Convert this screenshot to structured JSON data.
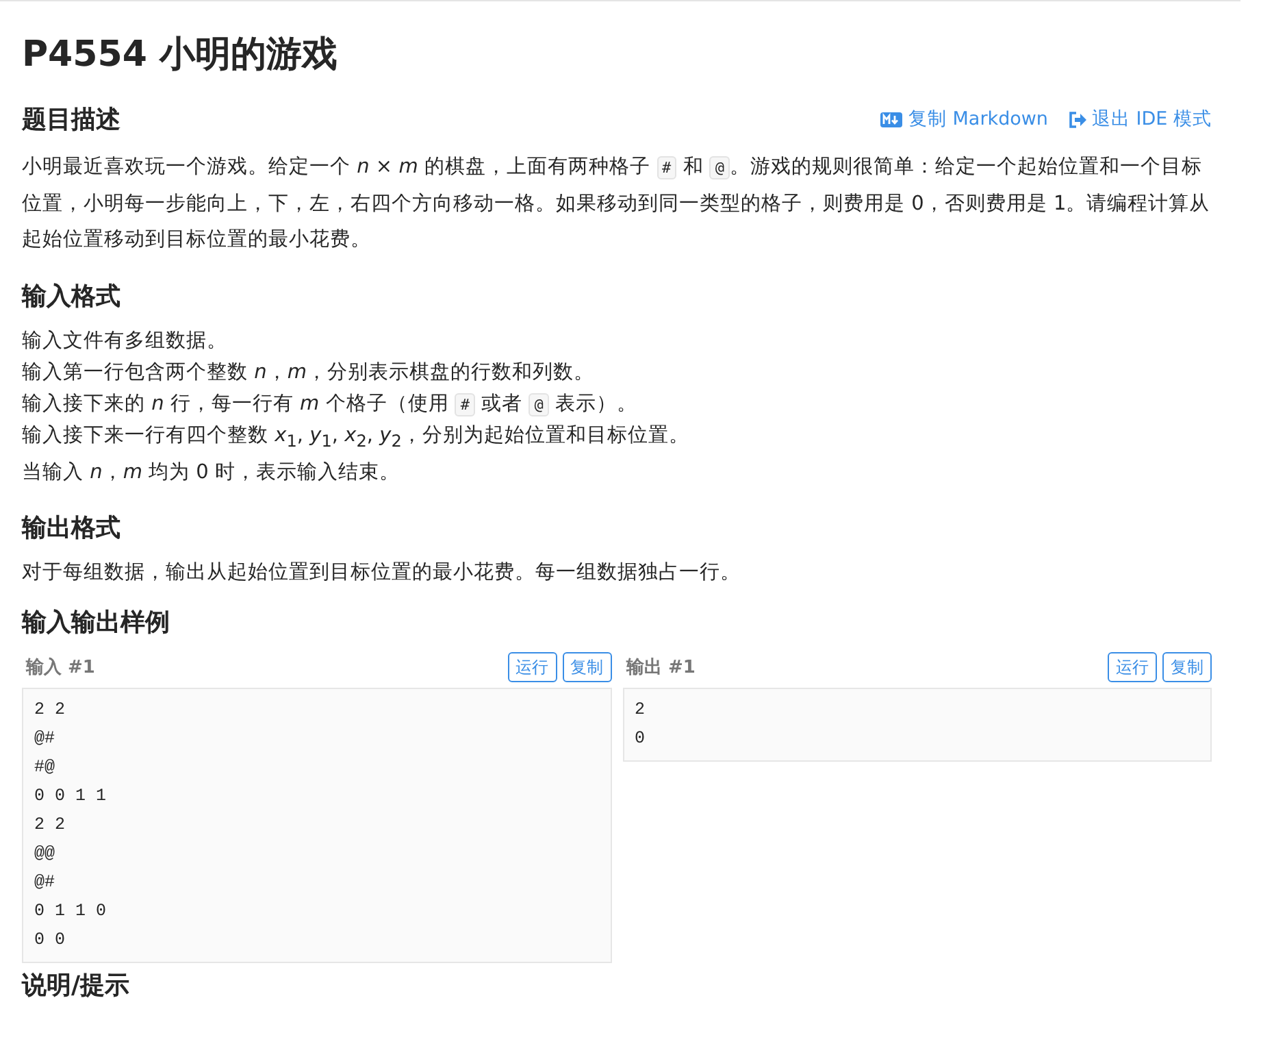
{
  "title": "P4554 小明的游戏",
  "actions": [
    {
      "kind": "markdown",
      "label": "复制 Markdown"
    },
    {
      "kind": "exit",
      "label": "退出 IDE 模式"
    }
  ],
  "sections": [
    {
      "heading": "题目描述",
      "lines": [
        [
          {
            "kind": "text",
            "text": "小明最近喜欢玩一个游戏。给定一个 *n* × *m* 的棋盘，上面有两种格子 "
          },
          {
            "kind": "code",
            "text": "#"
          },
          {
            "kind": "text",
            "text": " 和 "
          },
          {
            "kind": "code",
            "text": "@"
          },
          {
            "kind": "text",
            "text": "。游戏的规则很简单：给定一个起始位置和一个目标位置，小明每一步能向上，下，左，右四个方向移动一格。如果移动到同一类型的格子，则费用是 0，否则费用是 1。请编程计算从起始位置移动到目标位置的最小花费。"
          }
        ]
      ]
    },
    {
      "heading": "输入格式",
      "lines": [
        [
          {
            "kind": "text",
            "text": "输入文件有多组数据。"
          }
        ],
        [
          {
            "kind": "text",
            "text": "输入第一行包含两个整数 *n*，*m*，分别表示棋盘的行数和列数。"
          }
        ],
        [
          {
            "kind": "text",
            "text": "输入接下来的 *n* 行，每一行有 *m* 个格子（使用 "
          },
          {
            "kind": "code",
            "text": "#"
          },
          {
            "kind": "text",
            "text": " 或者 "
          },
          {
            "kind": "code",
            "text": "@"
          },
          {
            "kind": "text",
            "text": " 表示）。"
          }
        ],
        [
          {
            "kind": "text",
            "text": "输入接下来一行有四个整数 *x*$_{1}$, *y*$_{1}$, *x*$_{2}$, *y*$_{2}$，分别为起始位置和目标位置。"
          }
        ],
        [
          {
            "kind": "text",
            "text": "当输入 *n*，*m* 均为 0 时，表示输入结束。"
          }
        ]
      ]
    },
    {
      "heading": "输出格式",
      "lines": [
        [
          {
            "kind": "text",
            "text": "对于每组数据，输出从起始位置到目标位置的最小花费。每一组数据独占一行。"
          }
        ]
      ]
    }
  ],
  "samples_heading": "输入输出样例",
  "samples": [
    {
      "label": "输入 #1",
      "buttons": [
        "运行",
        "复制"
      ],
      "lines": [
        "2 2",
        "@#",
        "#@",
        "0 0 1 1",
        "2 2",
        "@@",
        "@#",
        "0 1 1 0",
        "0 0"
      ]
    },
    {
      "label": "输出 #1",
      "buttons": [
        "运行",
        "复制"
      ],
      "lines": [
        "2",
        "0"
      ]
    }
  ],
  "hint_heading": "说明/提示"
}
